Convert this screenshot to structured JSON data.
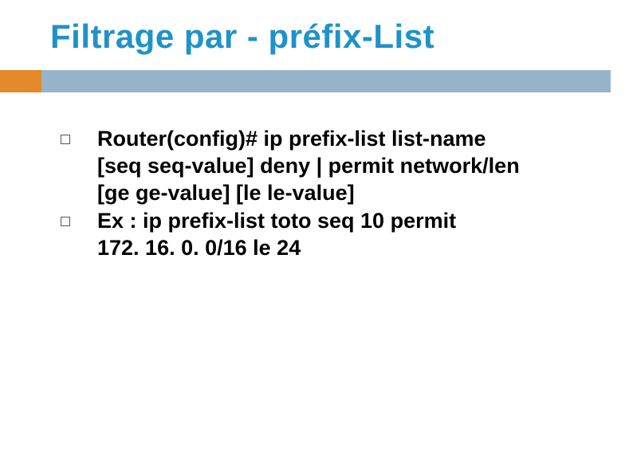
{
  "title": "Filtrage par  -  préfix-List",
  "bullets": [
    {
      "line1": "Router(config)# ip prefix-list list-name",
      "line2": "[seq seq-value] deny | permit network/len",
      "line3": "[ge ge-value] [le le-value]"
    },
    {
      "line1": "Ex : ip prefix-list toto  seq 10  permit",
      "line2": "172. 16. 0. 0/16 le 24"
    }
  ]
}
